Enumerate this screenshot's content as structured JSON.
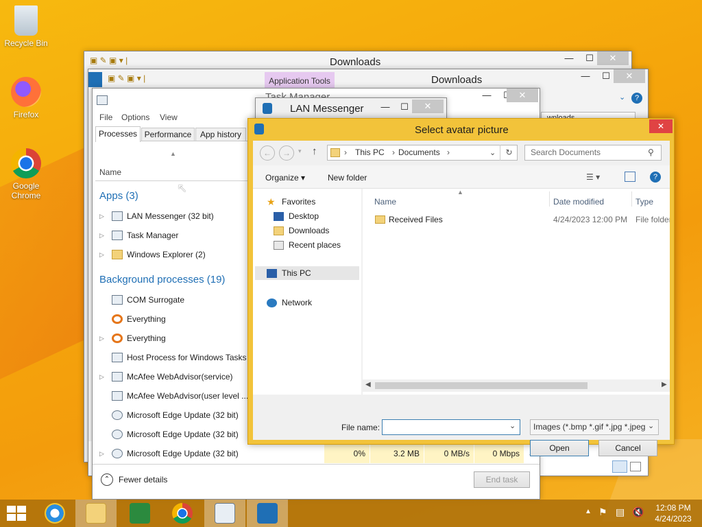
{
  "desktop": {
    "icons": [
      {
        "label": "Recycle Bin"
      },
      {
        "label": "Firefox"
      },
      {
        "label": "Google Chrome"
      }
    ]
  },
  "explorer_back": {
    "title": "Downloads"
  },
  "explorer_front": {
    "title": "Downloads",
    "ribbon_tab": "Application Tools",
    "address_partial": "wnloads"
  },
  "task_manager": {
    "title": "Task Manager",
    "menu": [
      "File",
      "Options",
      "View"
    ],
    "tabs": [
      "Processes",
      "Performance",
      "App history"
    ],
    "column_name": "Name",
    "apps_header": "Apps (3)",
    "apps": [
      "LAN Messenger (32 bit)",
      "Task Manager",
      "Windows Explorer (2)"
    ],
    "bg_header": "Background processes (19)",
    "bg": [
      "COM Surrogate",
      "Everything",
      "Everything",
      "Host Process for Windows Tasks",
      "McAfee WebAdvisor(service)",
      "McAfee WebAdvisor(user level ...",
      "Microsoft Edge Update (32 bit)",
      "Microsoft Edge Update (32 bit)",
      "Microsoft Edge Update (32 bit)"
    ],
    "last_row_values": {
      "cpu": "0%",
      "mem": "3.2 MB",
      "disk": "0 MB/s",
      "net": "0 Mbps"
    },
    "fewer_details": "Fewer details",
    "end_task": "End task"
  },
  "lan_messenger": {
    "title": "LAN Messenger"
  },
  "dialog": {
    "title": "Select avatar picture",
    "breadcrumb": [
      "This PC",
      "Documents"
    ],
    "search_placeholder": "Search Documents",
    "organize": "Organize",
    "new_folder": "New folder",
    "nav": {
      "favorites": "Favorites",
      "favorites_items": [
        "Desktop",
        "Downloads",
        "Recent places"
      ],
      "this_pc": "This PC",
      "network": "Network"
    },
    "columns": {
      "name": "Name",
      "date": "Date modified",
      "type": "Type"
    },
    "files": [
      {
        "name": "Received Files",
        "date": "4/24/2023 12:00 PM",
        "type": "File folder"
      }
    ],
    "file_name_label": "File name:",
    "file_name_value": "",
    "filter": "Images (*.bmp *.gif *.jpg *.jpeg",
    "open": "Open",
    "cancel": "Cancel"
  },
  "taskbar": {
    "time": "12:08 PM",
    "date": "4/24/2023"
  },
  "colors": {
    "accent": "#1f6fb5",
    "dialog_frame": "#f2c33a",
    "close_red": "#e04343"
  }
}
